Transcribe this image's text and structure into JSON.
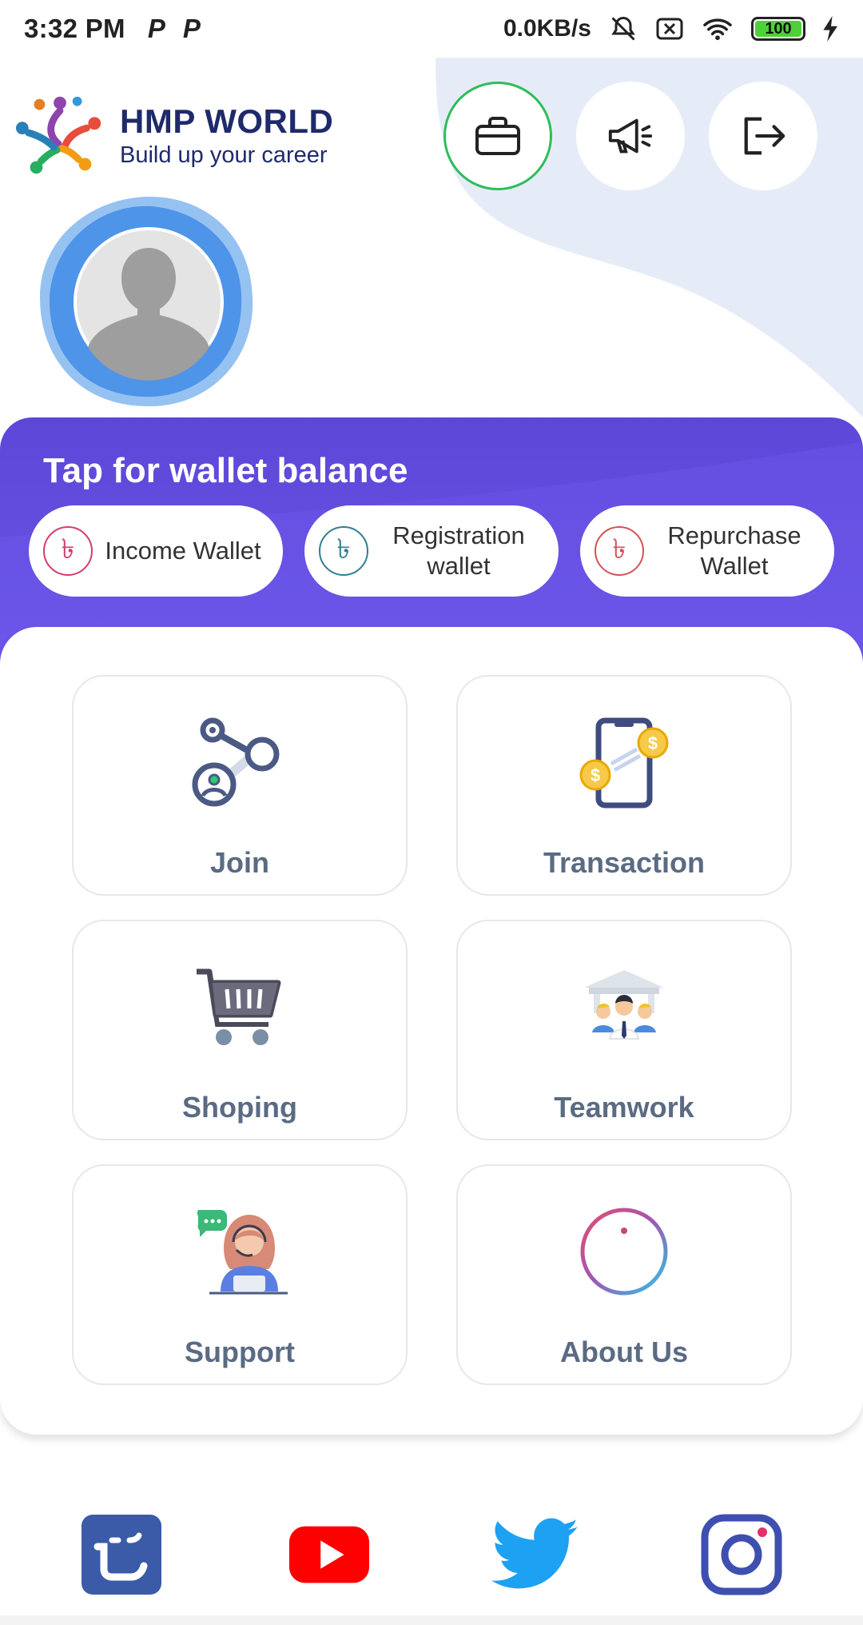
{
  "status_bar": {
    "time": "3:32 PM",
    "notif_1": "P",
    "notif_2": "P",
    "speed": "0.0KB/s",
    "battery": "100"
  },
  "brand": {
    "title": "HMP WORLD",
    "subtitle": "Build up your career"
  },
  "header_buttons": [
    "briefcase-icon",
    "megaphone-icon",
    "logout-icon"
  ],
  "wallet": {
    "title": "Tap for wallet balance",
    "currency_symbol": "৳",
    "pills": [
      {
        "label": "Income Wallet",
        "color": "#d63b6e"
      },
      {
        "label": "Registration wallet",
        "color": "#2f7f8f"
      },
      {
        "label": "Repurchase Wallet",
        "color": "#d0545a"
      }
    ]
  },
  "menu": [
    {
      "label": "Join",
      "icon": "join-network-icon"
    },
    {
      "label": "Transaction",
      "icon": "phone-money-icon"
    },
    {
      "label": "Shoping",
      "icon": "shopping-cart-icon"
    },
    {
      "label": "Teamwork",
      "icon": "team-icon"
    },
    {
      "label": "Support",
      "icon": "support-agent-icon"
    },
    {
      "label": "About Us",
      "icon": "info-icon"
    }
  ],
  "social": [
    "app-logo-icon",
    "youtube-icon",
    "twitter-icon",
    "instagram-icon"
  ],
  "colors": {
    "accent": "#5d47d8",
    "active_ring": "#2ebd5a",
    "label": "#5a6b83",
    "brand": "#1f2a6b"
  }
}
